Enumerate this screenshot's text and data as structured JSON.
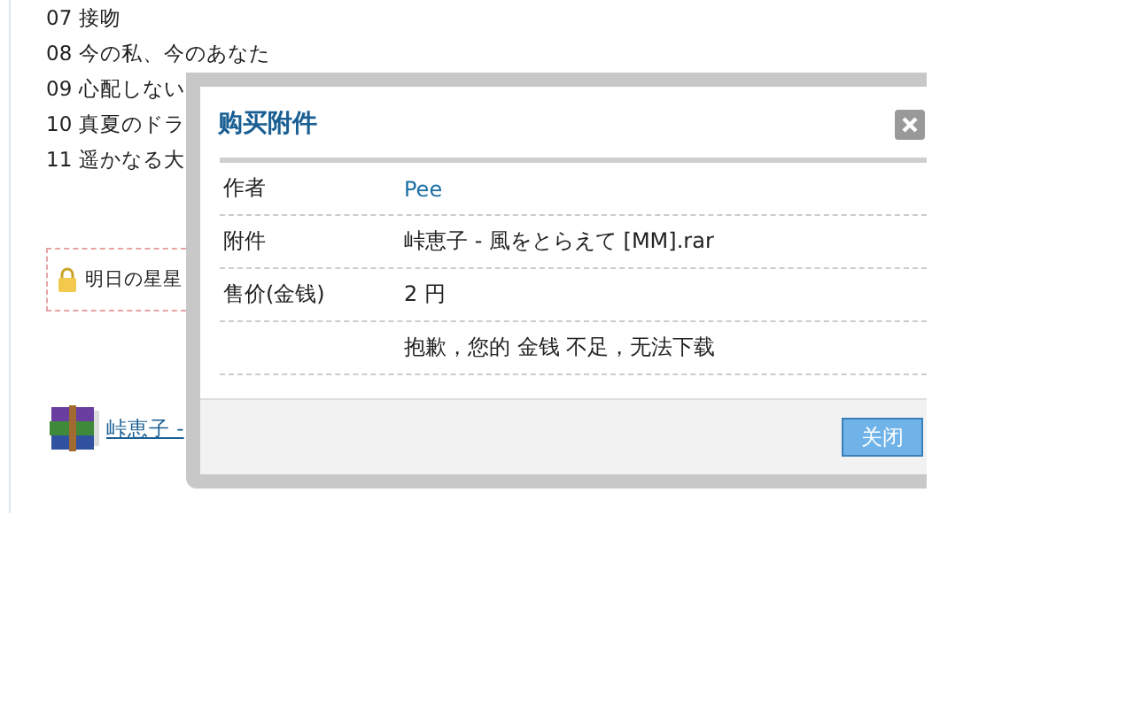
{
  "tracks": [
    "07 接吻",
    "08 今の私、今のあなた",
    "09 心配しない",
    "10 真夏のドラ",
    "11 遥かなる大"
  ],
  "locked_item": {
    "label": "明日の星星"
  },
  "attachment_link": {
    "label": "峠恵子 -"
  },
  "dialog": {
    "title": "购买附件",
    "rows": [
      {
        "label": "作者",
        "value": "Pee",
        "kind": "link"
      },
      {
        "label": "附件",
        "value": "峠恵子 - 風をとらえて [MM].rar",
        "kind": "text"
      },
      {
        "label": "售价(金钱)",
        "value": "2 円",
        "kind": "text"
      },
      {
        "value": "抱歉，您的 金钱 不足，无法下载",
        "kind": "text"
      }
    ],
    "buttons": [
      "关闭"
    ]
  }
}
